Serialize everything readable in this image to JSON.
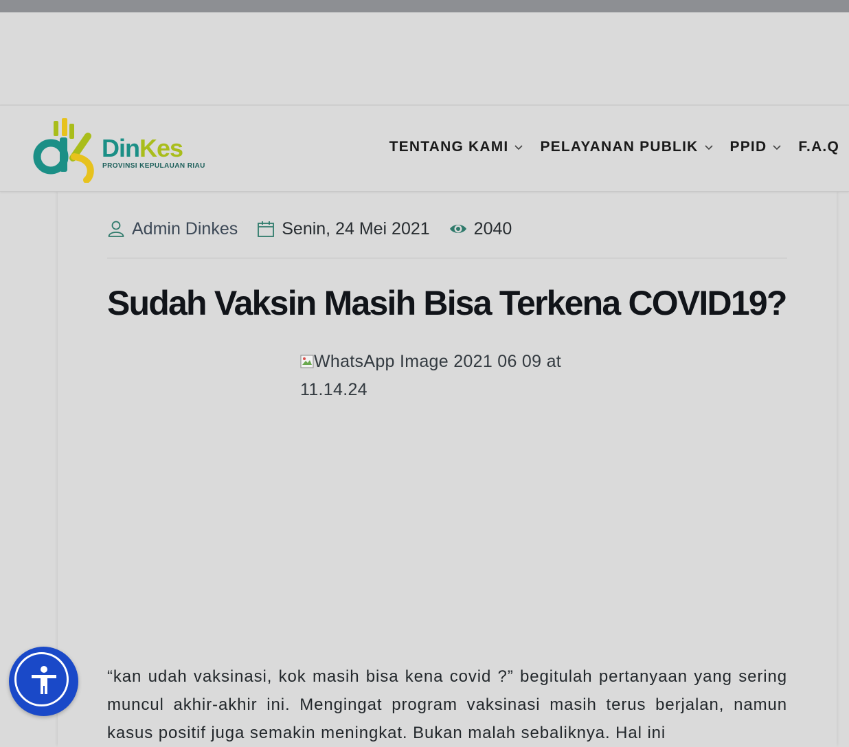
{
  "logo": {
    "text_din": "Din",
    "text_kes": "Kes",
    "subtitle": "PROVINSI KEPULAUAN RIAU",
    "colors": {
      "teal": "#1b8f86",
      "lime": "#a9bd1b",
      "gold": "#e7c21d"
    }
  },
  "nav": {
    "items": [
      {
        "label": "TENTANG KAMI",
        "dropdown": true
      },
      {
        "label": "PELAYANAN PUBLIK",
        "dropdown": true
      },
      {
        "label": "PPID",
        "dropdown": true
      },
      {
        "label": "F.A.Q",
        "dropdown": false
      }
    ]
  },
  "meta": {
    "author": "Admin Dinkes",
    "date": "Senin, 24 Mei 2021",
    "views": "2040",
    "icons": [
      "user-icon",
      "calendar-icon",
      "eye-icon"
    ]
  },
  "article": {
    "title": "Sudah Vaksin Masih Bisa Terkena COVID19?",
    "image_alt": "WhatsApp Image 2021 06 09 at 11.14.24",
    "body": "“kan udah vaksinasi, kok masih bisa kena covid ?” begitulah pertanyaan yang sering muncul akhir-akhir ini. Mengingat program vaksinasi masih terus berjalan, namun kasus positif juga semakin meningkat. Bukan malah sebaliknya. Hal ini"
  },
  "accessibility": {
    "icon": "accessibility-icon",
    "color": "#1a49c8"
  }
}
